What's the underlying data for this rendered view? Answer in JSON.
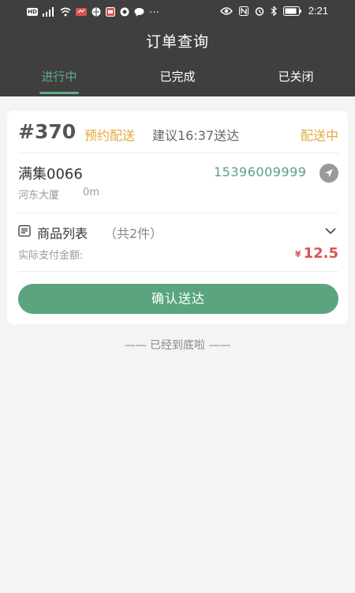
{
  "status_bar": {
    "time": "2:21",
    "hd_badge": "HD",
    "more": "···"
  },
  "header": {
    "title": "订单查询"
  },
  "tabs": [
    {
      "label": "进行中",
      "active": true
    },
    {
      "label": "已完成",
      "active": false
    },
    {
      "label": "已关闭",
      "active": false
    }
  ],
  "order": {
    "number": "#370",
    "type": "预约配送",
    "eta": "建议16:37送达",
    "status": "配送中",
    "customer": {
      "name": "满集0066",
      "phone": "15396009999",
      "address": "河东大厦",
      "distance": "0m"
    },
    "goods": {
      "label": "商品列表",
      "count": "（共2件）"
    },
    "payment": {
      "label": "实际支付金额:",
      "currency": "¥",
      "amount": "12.5"
    },
    "confirm_label": "确认送达"
  },
  "footer": {
    "end_note": "—— 已经到底啦 ——"
  },
  "colors": {
    "accent": "#5aa57f",
    "warning": "#e6a93c",
    "price": "#d9534f",
    "header_bg": "#3f3f3f"
  }
}
